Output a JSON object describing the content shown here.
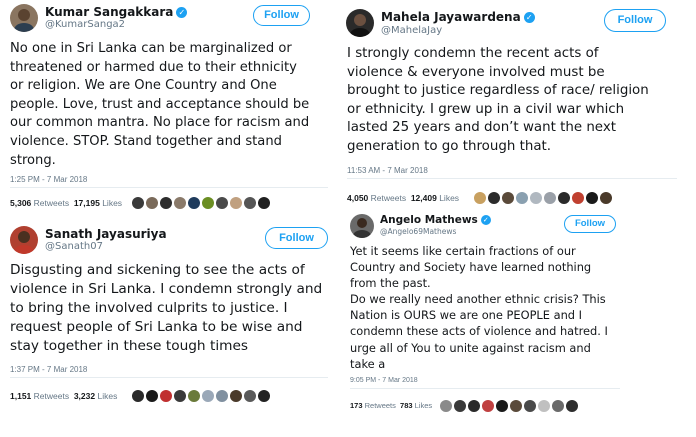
{
  "tweets": [
    {
      "name": "Kumar Sangakkara",
      "handle": "@KumarSanga2",
      "follow": "Follow",
      "text": "No one in Sri Lanka can be marginalized or\nthreatened or harmed due to their ethnicity\nor religion.  We are One Country and One\npeople. Love, trust and acceptance should be\nour common mantra. No place for racism and\nviolence. STOP. Stand together and stand\nstrong.",
      "time": "1:25 PM - 7 Mar 2018",
      "retweets_count": "5,306",
      "retweets_label": "Retweets",
      "likes_count": "17,195",
      "likes_label": "Likes",
      "likers": [
        "#3a3a3a",
        "#7a6a5a",
        "#2d2d2d",
        "#8a7a6a",
        "#1f3b5c",
        "#6b8e23",
        "#4a4a4a",
        "#c0a080",
        "#555555",
        "#202020"
      ]
    },
    {
      "name": "Mahela Jayawardena",
      "handle": "@MahelaJay",
      "follow": "Follow",
      "text": "I strongly condemn the recent acts of\nviolence & everyone involved must be\nbrought to justice regardless of race/ religion\nor ethnicity. I grew up in a civil war which\nlasted 25 years and don’t want the next\ngeneration to go through that.",
      "time": "11:53 AM - 7 Mar 2018",
      "retweets_count": "4,050",
      "retweets_label": "Retweets",
      "likes_count": "12,409",
      "likes_label": "Likes",
      "likers": [
        "#c8a060",
        "#2b2b2b",
        "#5a4a3a",
        "#8aa0b0",
        "#b0b8c0",
        "#9aa0a8",
        "#2a2a2a",
        "#c04030",
        "#1a1a1a",
        "#4a3a2a"
      ]
    },
    {
      "name": "Sanath Jayasuriya",
      "handle": "@Sanath07",
      "follow": "Follow",
      "text": "Disgusting and sickening to see the acts of\nviolence in Sri Lanka. I condemn strongly and\nto bring the involved culprits to justice. I\nrequest people of Sri Lanka to be wise and\nstay together in these tough times",
      "time": "1:37 PM - 7 Mar 2018",
      "retweets_count": "1,151",
      "retweets_label": "Retweets",
      "likes_count": "3,232",
      "likes_label": "Likes",
      "likers": [
        "#2a2a2a",
        "#1a1a1a",
        "#c03030",
        "#3a3a3a",
        "#6a7a3a",
        "#9aa8b8",
        "#8090a0",
        "#4a3a2a",
        "#5a5a5a",
        "#222222"
      ]
    },
    {
      "name": "Angelo Mathews",
      "handle": "@Angelo69Mathews",
      "follow": "Follow",
      "text": "Yet it seems like certain fractions of our\nCountry and Society have learned nothing\nfrom the past.\nDo we really need another ethnic crisis? This\nNation is OURS we are one PEOPLE and I\ncondemn these acts of violence and hatred. I\nurge all of You to unite against racism and\ntake a",
      "time": "9:05 PM - 7 Mar 2018",
      "retweets_count": "173",
      "retweets_label": "Retweets",
      "likes_count": "783",
      "likes_label": "Likes",
      "likers": [
        "#8a8a8a",
        "#3a3a3a",
        "#2a2a2a",
        "#c04040",
        "#1a1a1a",
        "#5a4a3a",
        "#4a4a4a",
        "#c0c0c0",
        "#6a6a6a",
        "#2d2d2d"
      ]
    }
  ]
}
